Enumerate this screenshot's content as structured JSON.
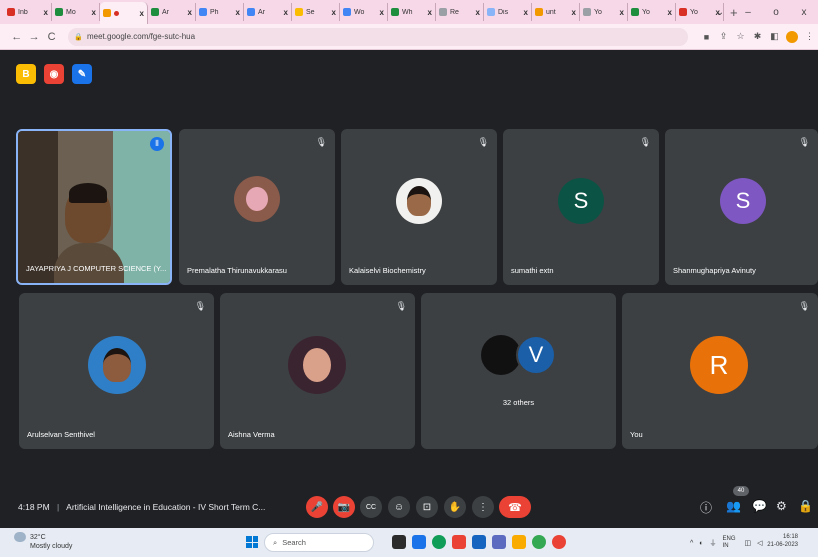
{
  "browser": {
    "tabs": [
      {
        "label": "Inb",
        "color": "#d93025"
      },
      {
        "label": "Mo",
        "color": "#1e8e3e"
      },
      {
        "label": "",
        "color": "#f29900",
        "active": true
      },
      {
        "label": "Ar",
        "color": "#1e8e3e"
      },
      {
        "label": "Ph",
        "color": "#4285f4"
      },
      {
        "label": "Ar",
        "color": "#4285f4"
      },
      {
        "label": "Se",
        "color": "#fbbc04"
      },
      {
        "label": "Wo",
        "color": "#4285f4"
      },
      {
        "label": "Wh",
        "color": "#1e8e3e"
      },
      {
        "label": "Re",
        "color": "#9aa0a6"
      },
      {
        "label": "Dis",
        "color": "#8ab4f8"
      },
      {
        "label": "unt",
        "color": "#f29900"
      },
      {
        "label": "Yo",
        "color": "#9aa0a6"
      },
      {
        "label": "Yo",
        "color": "#1e8e3e"
      },
      {
        "label": "Yo",
        "color": "#d93025"
      }
    ],
    "tab_close": "x",
    "new_tab": "+",
    "window_controls": [
      "⌄",
      "–",
      "o",
      "x"
    ],
    "nav": {
      "back": "←",
      "forward": "→",
      "reload": "C"
    },
    "url": "meet.google.com/fge-sutc-hua"
  },
  "meet": {
    "top_buttons": [
      {
        "icon": "B",
        "color": "#fbbc04"
      },
      {
        "icon": "◉",
        "color": "#ea4335"
      },
      {
        "icon": "✎",
        "color": "#1a73e8"
      }
    ],
    "participants": [
      {
        "name": "JAYAPRIYA J COMPUTER SCIENCE (Y...",
        "type": "video",
        "speaking": true
      },
      {
        "name": "Premalatha Thirunavukkarasu",
        "type": "photo"
      },
      {
        "name": "Kalaiselvi Biochemistry",
        "type": "photo"
      },
      {
        "name": "sumathi extn",
        "type": "initial",
        "initial": "S",
        "color": "#0b5345"
      },
      {
        "name": "Shanmughapriya Avinuty",
        "type": "initial",
        "initial": "S",
        "color": "#7e57c2"
      },
      {
        "name": "Arulselvan Senthivel",
        "type": "photo"
      },
      {
        "name": "Aishna Verma",
        "type": "photo"
      },
      {
        "name": "32 others",
        "type": "group",
        "initial": "V",
        "color": "#1a5fa8"
      },
      {
        "name": "You",
        "type": "initial",
        "initial": "R",
        "color": "#e8710a"
      }
    ],
    "mute_icon": "🎙",
    "time": "4:18 PM",
    "separator": "|",
    "meeting_title": "Artificial Intelligence in Education - IV Short Term C...",
    "controls": [
      "🎤",
      "📷",
      "CC",
      "☺",
      "⊡",
      "✋",
      "⋮"
    ],
    "end_call": "☎",
    "right_controls": [
      "ⓘ",
      "👥",
      "💬",
      "⚙",
      "🔒"
    ],
    "people_count": "40"
  },
  "taskbar": {
    "weather_temp": "32°C",
    "weather_desc": "Mostly cloudy",
    "search_placeholder": "Search",
    "tray_lang": "ENG IN",
    "clock_time": "16:18",
    "clock_date": "21-06-2023"
  }
}
